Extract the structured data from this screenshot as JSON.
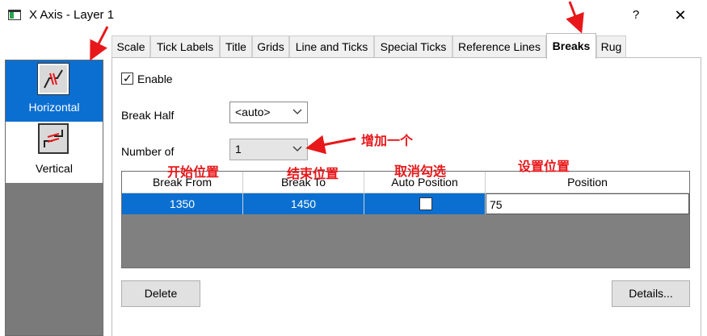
{
  "window": {
    "title": "X Axis - Layer 1",
    "help_glyph": "?",
    "close_glyph": "✕"
  },
  "left_pane": {
    "items": [
      {
        "label": "Horizontal",
        "selected": true,
        "icon": "horizontal-break-icon"
      },
      {
        "label": "Vertical",
        "selected": false,
        "icon": "vertical-break-icon"
      }
    ]
  },
  "tabs": [
    {
      "label": "Scale"
    },
    {
      "label": "Tick Labels"
    },
    {
      "label": "Title"
    },
    {
      "label": "Grids"
    },
    {
      "label": "Line and Ticks"
    },
    {
      "label": "Special Ticks"
    },
    {
      "label": "Reference Lines"
    },
    {
      "label": "Breaks",
      "active": true
    },
    {
      "label": "Rug"
    }
  ],
  "breaks": {
    "enable_label": "Enable",
    "enable_checked": true,
    "break_half_label": "Break Half",
    "break_half_value": "<auto>",
    "number_of_label": "Number of",
    "number_of_value": "1",
    "table": {
      "headers": [
        "Break From",
        "Break To",
        "Auto Position",
        "Position"
      ],
      "rows": [
        {
          "break_from": "1350",
          "break_to": "1450",
          "auto_position": false,
          "position": "75"
        }
      ]
    },
    "delete_label": "Delete",
    "details_label": "Details..."
  },
  "annotations": {
    "add_one": "增加一个",
    "start_position": "开始位置",
    "end_position": "结束位置",
    "uncheck": "取消勾选",
    "set_position": "设置位置",
    "color": "#e8171a"
  },
  "colors": {
    "selection": "#0a6fd1",
    "grid_background": "#808080"
  }
}
